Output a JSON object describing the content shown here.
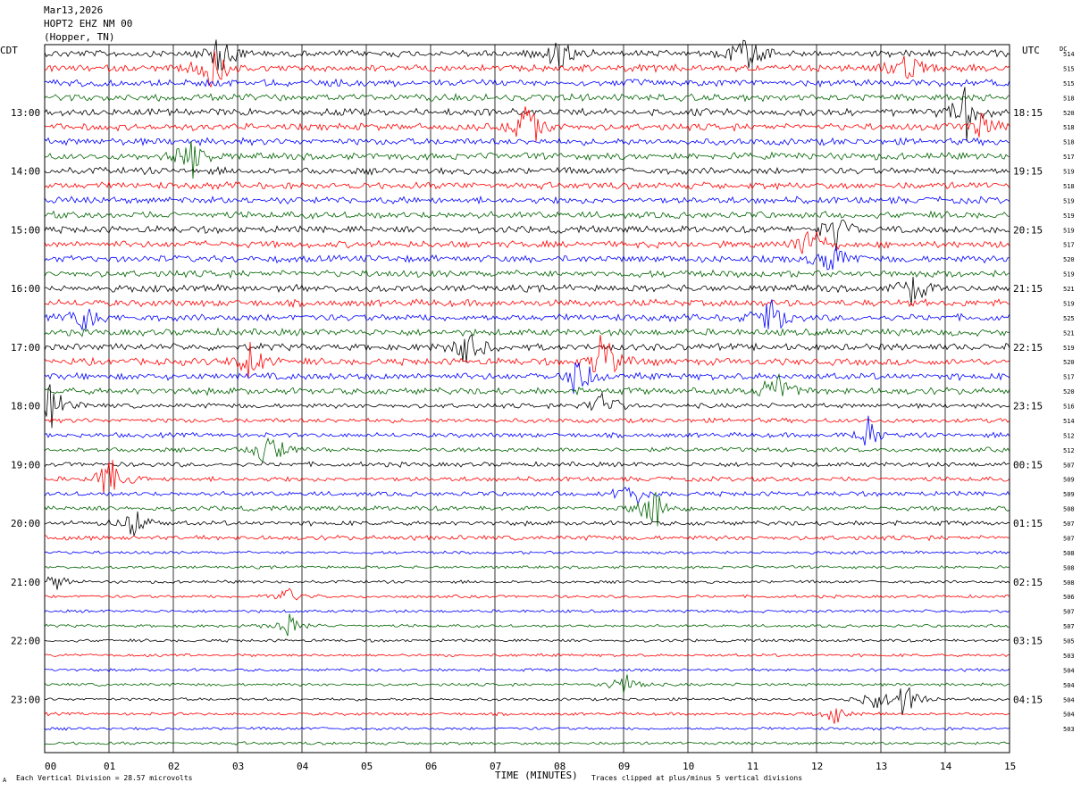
{
  "header": {
    "date": "Mar13,2026",
    "station": "HOPT2 EHZ NM 00",
    "location": "(Hopper, TN)"
  },
  "left_tz": "CDT",
  "right_tz": "UTC",
  "dc_label": "DC",
  "footer": {
    "scale": "Each Vertical Division =   28.57 microvolts",
    "xlabel": "TIME (MINUTES)",
    "clip": "Traces clipped at plus/minus 5 vertical divisions",
    "corner": "A"
  },
  "colors": {
    "cycle": [
      "#000000",
      "#ff0000",
      "#0000ff",
      "#006400"
    ]
  },
  "chart_data": {
    "type": "line",
    "title": "HOPT2 EHZ NM 00",
    "xlabel": "TIME (MINUTES)",
    "xlim": [
      0,
      15
    ],
    "x_ticks": [
      "00",
      "01",
      "02",
      "03",
      "04",
      "05",
      "06",
      "07",
      "08",
      "09",
      "10",
      "11",
      "12",
      "13",
      "14",
      "15"
    ],
    "left_time_labels": [
      "13:00",
      "14:00",
      "15:00",
      "16:00",
      "17:00",
      "18:00",
      "19:00",
      "20:00",
      "21:00",
      "22:00",
      "23:00"
    ],
    "right_time_labels": [
      "18:15",
      "19:15",
      "20:15",
      "21:15",
      "22:15",
      "23:15",
      "00:15",
      "01:15",
      "02:15",
      "03:15",
      "04:15"
    ],
    "trace_count": 48,
    "dc_offsets": [
      "514",
      "515",
      "515",
      "518",
      "520",
      "518",
      "518",
      "517",
      "519",
      "518",
      "519",
      "519",
      "519",
      "517",
      "520",
      "519",
      "521",
      "519",
      "525",
      "521",
      "519",
      "520",
      "517",
      "520",
      "516",
      "514",
      "512",
      "512",
      "507",
      "509",
      "509",
      "508",
      "507",
      "507",
      "508",
      "508",
      "508",
      "506",
      "507",
      "507",
      "505",
      "503",
      "504",
      "504",
      "504",
      "504",
      "503"
    ],
    "events": [
      {
        "trace": 0,
        "x": 2.75,
        "amp": 5
      },
      {
        "trace": 0,
        "x": 8.0,
        "amp": 3
      },
      {
        "trace": 0,
        "x": 10.9,
        "amp": 4
      },
      {
        "trace": 1,
        "x": 2.6,
        "amp": 5
      },
      {
        "trace": 1,
        "x": 13.4,
        "amp": 3
      },
      {
        "trace": 4,
        "x": 14.3,
        "amp": 5
      },
      {
        "trace": 5,
        "x": 7.5,
        "amp": 4
      },
      {
        "trace": 5,
        "x": 14.6,
        "amp": 4
      },
      {
        "trace": 7,
        "x": 2.3,
        "amp": 4
      },
      {
        "trace": 12,
        "x": 12.3,
        "amp": 3
      },
      {
        "trace": 13,
        "x": 11.9,
        "amp": 4
      },
      {
        "trace": 14,
        "x": 12.2,
        "amp": 4
      },
      {
        "trace": 16,
        "x": 13.5,
        "amp": 4
      },
      {
        "trace": 18,
        "x": 0.6,
        "amp": 3
      },
      {
        "trace": 18,
        "x": 11.3,
        "amp": 4
      },
      {
        "trace": 20,
        "x": 6.6,
        "amp": 4
      },
      {
        "trace": 21,
        "x": 3.2,
        "amp": 4
      },
      {
        "trace": 21,
        "x": 8.7,
        "amp": 5
      },
      {
        "trace": 22,
        "x": 8.3,
        "amp": 4
      },
      {
        "trace": 23,
        "x": 11.4,
        "amp": 4
      },
      {
        "trace": 24,
        "x": 0.1,
        "amp": 4
      },
      {
        "trace": 24,
        "x": 8.7,
        "amp": 3
      },
      {
        "trace": 26,
        "x": 12.8,
        "amp": 3
      },
      {
        "trace": 27,
        "x": 3.5,
        "amp": 4
      },
      {
        "trace": 29,
        "x": 1.0,
        "amp": 4
      },
      {
        "trace": 30,
        "x": 9.1,
        "amp": 3
      },
      {
        "trace": 31,
        "x": 9.5,
        "amp": 4
      },
      {
        "trace": 32,
        "x": 1.4,
        "amp": 3
      },
      {
        "trace": 36,
        "x": 0.1,
        "amp": 2
      },
      {
        "trace": 37,
        "x": 3.8,
        "amp": 2
      },
      {
        "trace": 39,
        "x": 3.8,
        "amp": 2
      },
      {
        "trace": 43,
        "x": 9.0,
        "amp": 2
      },
      {
        "trace": 44,
        "x": 13.4,
        "amp": 3
      },
      {
        "trace": 44,
        "x": 12.9,
        "amp": 2
      },
      {
        "trace": 45,
        "x": 12.3,
        "amp": 2
      }
    ]
  }
}
